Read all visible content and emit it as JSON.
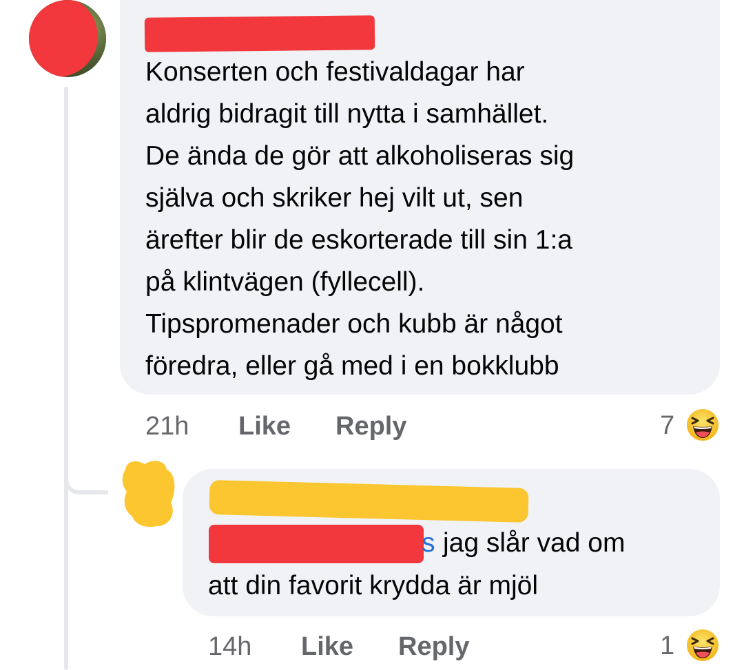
{
  "comment": {
    "text": "Konserten och festivaldagar har\naldrig bidragit till nytta i samhället.\nDe ända de gör att alkoholiseras sig\nsjälva och skriker hej vilt ut, sen\närefter blir de eskorterade till sin 1:a\npå klintvägen (fyllecell).\nTipspromenader och kubb är något\nföredra, eller gå med i en bokklubb",
    "time": "21h",
    "like_label": "Like",
    "reply_label": "Reply",
    "reaction_count": "7",
    "reaction_icon": "laughing-emoji-icon",
    "redaction_color": "#f2383c"
  },
  "reply": {
    "mention_tail": "s",
    "text_line1": "jag slår vad om",
    "text_line2": "att din favorit krydda är mjöl",
    "time": "14h",
    "like_label": "Like",
    "reply_label": "Reply",
    "reaction_count": "1",
    "reaction_icon": "laughing-emoji-icon",
    "redaction_color": "#fbc62f",
    "mention_color": "#216fdb"
  },
  "colors": {
    "bubble": "#f0f2f5",
    "text": "#050505",
    "meta": "#65676b",
    "thread_line": "#e6e7eb"
  }
}
